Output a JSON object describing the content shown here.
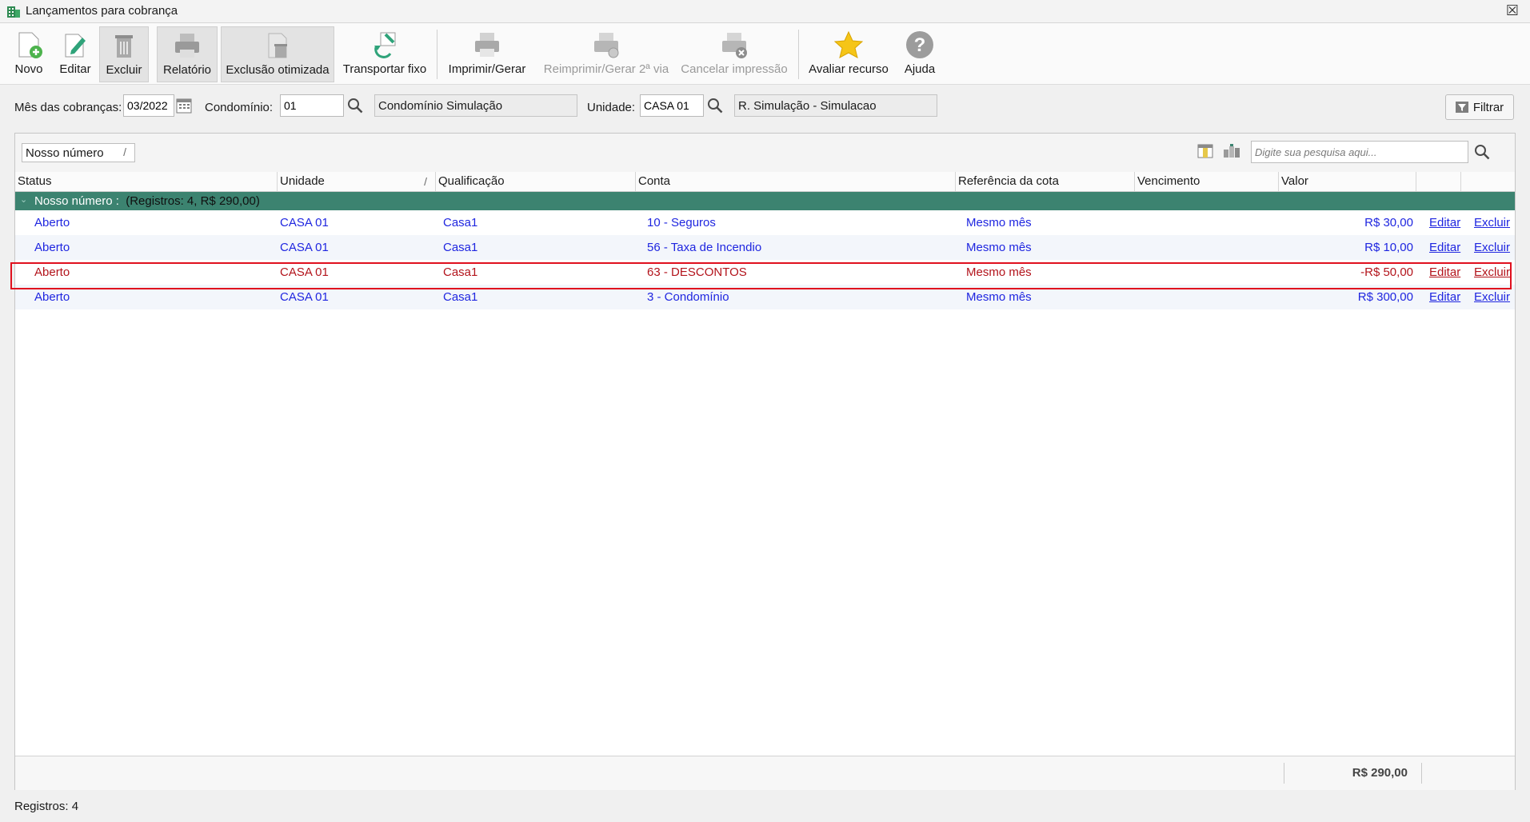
{
  "window": {
    "title": "Lançamentos para cobrança",
    "close_glyph": "☒"
  },
  "toolbar": {
    "novo": "Novo",
    "editar": "Editar",
    "excluir": "Excluir",
    "relatorio": "Relatório",
    "exclusao_otimizada": "Exclusão otimizada",
    "transportar_fixo": "Transportar fixo",
    "imprimir_gerar": "Imprimir/Gerar",
    "reimprimir": "Reimprimir/Gerar 2ª via",
    "cancelar_impressao": "Cancelar impressão",
    "avaliar_recurso": "Avaliar recurso",
    "ajuda": "Ajuda"
  },
  "filters": {
    "mes_label": "Mês das cobranças:",
    "mes_value": "03/2022",
    "condominio_label": "Condomínio:",
    "condominio_value": "01",
    "condominio_name": "Condomínio Simulação",
    "unidade_label": "Unidade:",
    "unidade_value": "CASA 01",
    "unidade_name": "R. Simulação  - Simulacao",
    "filtrar": "Filtrar"
  },
  "grid": {
    "group_chip": "Nosso número",
    "search_placeholder": "Digite sua pesquisa aqui...",
    "columns": [
      "Status",
      "Unidade",
      "Qualificação",
      "Conta",
      "Referência da cota",
      "Vencimento",
      "Valor"
    ],
    "group_label": "Nosso número :",
    "group_count": "(Registros: 4, R$ 290,00)",
    "rows": [
      {
        "status": "Aberto",
        "unidade": "CASA 01",
        "qualificacao": "Casa1",
        "conta": "10 - Seguros",
        "referencia": "Mesmo mês",
        "vencimento": "",
        "valor": "R$ 30,00",
        "editar": "Editar",
        "excluir": "Excluir"
      },
      {
        "status": "Aberto",
        "unidade": "CASA 01",
        "qualificacao": "Casa1",
        "conta": "56 - Taxa de Incendio",
        "referencia": "Mesmo mês",
        "vencimento": "",
        "valor": "R$ 10,00",
        "editar": "Editar",
        "excluir": "Excluir"
      },
      {
        "status": "Aberto",
        "unidade": "CASA 01",
        "qualificacao": "Casa1",
        "conta": "63 - DESCONTOS",
        "referencia": "Mesmo mês",
        "vencimento": "",
        "valor": "-R$ 50,00",
        "editar": "Editar",
        "excluir": "Excluir"
      },
      {
        "status": "Aberto",
        "unidade": "CASA 01",
        "qualificacao": "Casa1",
        "conta": "3 - Condomínio",
        "referencia": "Mesmo mês",
        "vencimento": "",
        "valor": "R$ 300,00",
        "editar": "Editar",
        "excluir": "Excluir"
      }
    ],
    "total": "R$ 290,00"
  },
  "status_bar": {
    "registros": "Registros: 4"
  },
  "colors": {
    "accent_green": "#3c8370",
    "link_blue": "#1f26e0",
    "negative_red": "#b3141c",
    "highlight_red": "#e0101e"
  }
}
